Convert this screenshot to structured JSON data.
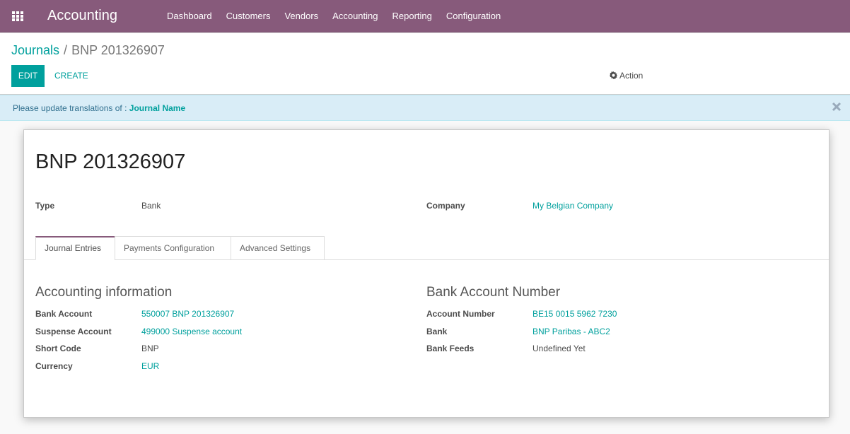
{
  "nav": {
    "brand": "Accounting",
    "menu": [
      "Dashboard",
      "Customers",
      "Vendors",
      "Accounting",
      "Reporting",
      "Configuration"
    ]
  },
  "breadcrumb": {
    "parent": "Journals",
    "separator": "/",
    "current": "BNP 201326907"
  },
  "toolbar": {
    "edit": "EDIT",
    "create": "CREATE",
    "action": "Action"
  },
  "alert": {
    "text": "Please update translations of :",
    "link": "Journal Name"
  },
  "record": {
    "title": "BNP 201326907",
    "type_label": "Type",
    "type_value": "Bank",
    "company_label": "Company",
    "company_value": "My Belgian Company"
  },
  "tabs": [
    "Journal Entries",
    "Payments Configuration",
    "Advanced Settings"
  ],
  "accounting": {
    "heading": "Accounting information",
    "fields": [
      {
        "label": "Bank Account",
        "value": "550007 BNP 201326907"
      },
      {
        "label": "Suspense Account",
        "value": "499000 Suspense account"
      },
      {
        "label": "Short Code",
        "value": "BNP"
      },
      {
        "label": "Currency",
        "value": "EUR"
      }
    ]
  },
  "bank": {
    "heading": "Bank Account Number",
    "fields": [
      {
        "label": "Account Number",
        "value": "BE15 0015 5962 7230"
      },
      {
        "label": "Bank",
        "value": "BNP Paribas - ABC2"
      },
      {
        "label": "Bank Feeds",
        "value": "Undefined Yet"
      }
    ]
  },
  "colors": {
    "brand": "#875a7b",
    "accent": "#00a09d"
  }
}
